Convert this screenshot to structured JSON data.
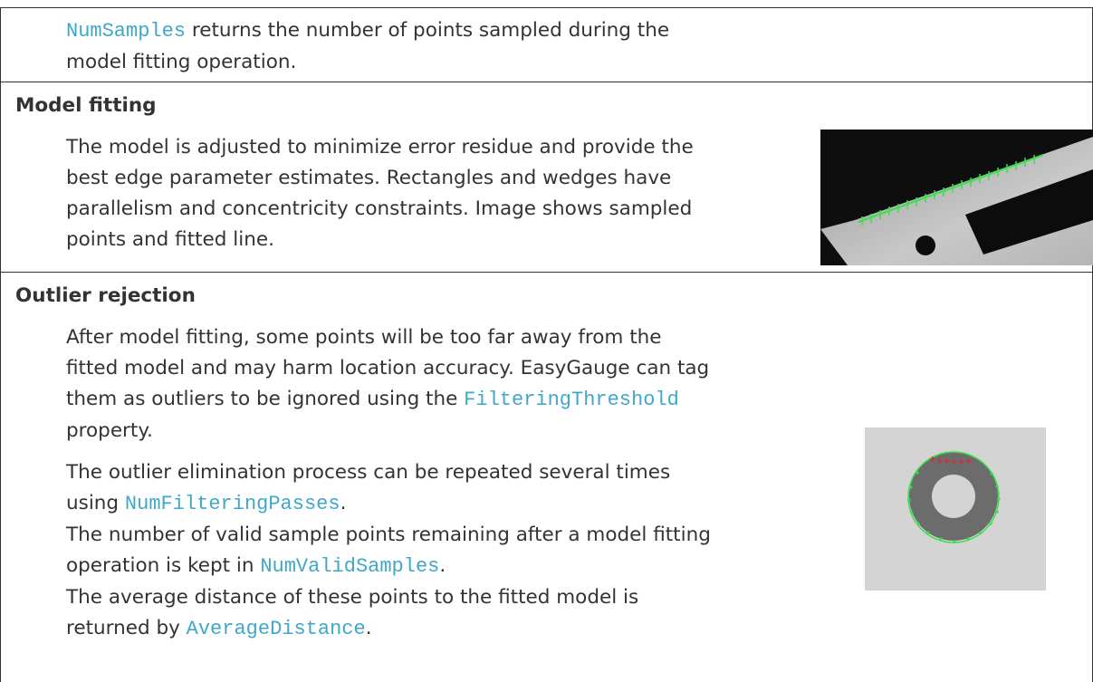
{
  "row1": {
    "code": "NumSamples",
    "text_after_code": " returns the number of points sampled during the",
    "line2": "model fitting operation."
  },
  "model_fitting": {
    "heading": "Model fitting",
    "lines": [
      "The model is adjusted to minimize error residue and provide the",
      "best edge parameter estimates. Rectangles and wedges have",
      "parallelism and concentricity constraints. Image shows sampled",
      "points and fitted line."
    ]
  },
  "outlier_rejection": {
    "heading": "Outlier rejection",
    "p1": {
      "line1": "After model fitting, some points will be too far away from the",
      "line2": "fitted model and may harm location accuracy. EasyGauge can tag",
      "line3_before": "them as outliers to be ignored using the ",
      "line3_code": "FilteringThreshold",
      "line4": "property."
    },
    "p2": {
      "line1": "The outlier elimination process can be repeated several times",
      "line2_before": "using ",
      "line2_code": "NumFilteringPasses",
      "line2_after": ".",
      "line3": "The number of valid sample points remaining after a model fitting",
      "line4_before": "operation is kept in ",
      "line4_code": "NumValidSamples",
      "line4_after": ".",
      "line5": "The average distance of these points to the fitted model is",
      "line6_before": "returned by ",
      "line6_code": "AverageDistance",
      "line6_after": "."
    }
  },
  "colors": {
    "text": "#333333",
    "code": "#3fa7c9",
    "sample_points": "#39e04a",
    "outliers": "#e8242e"
  }
}
